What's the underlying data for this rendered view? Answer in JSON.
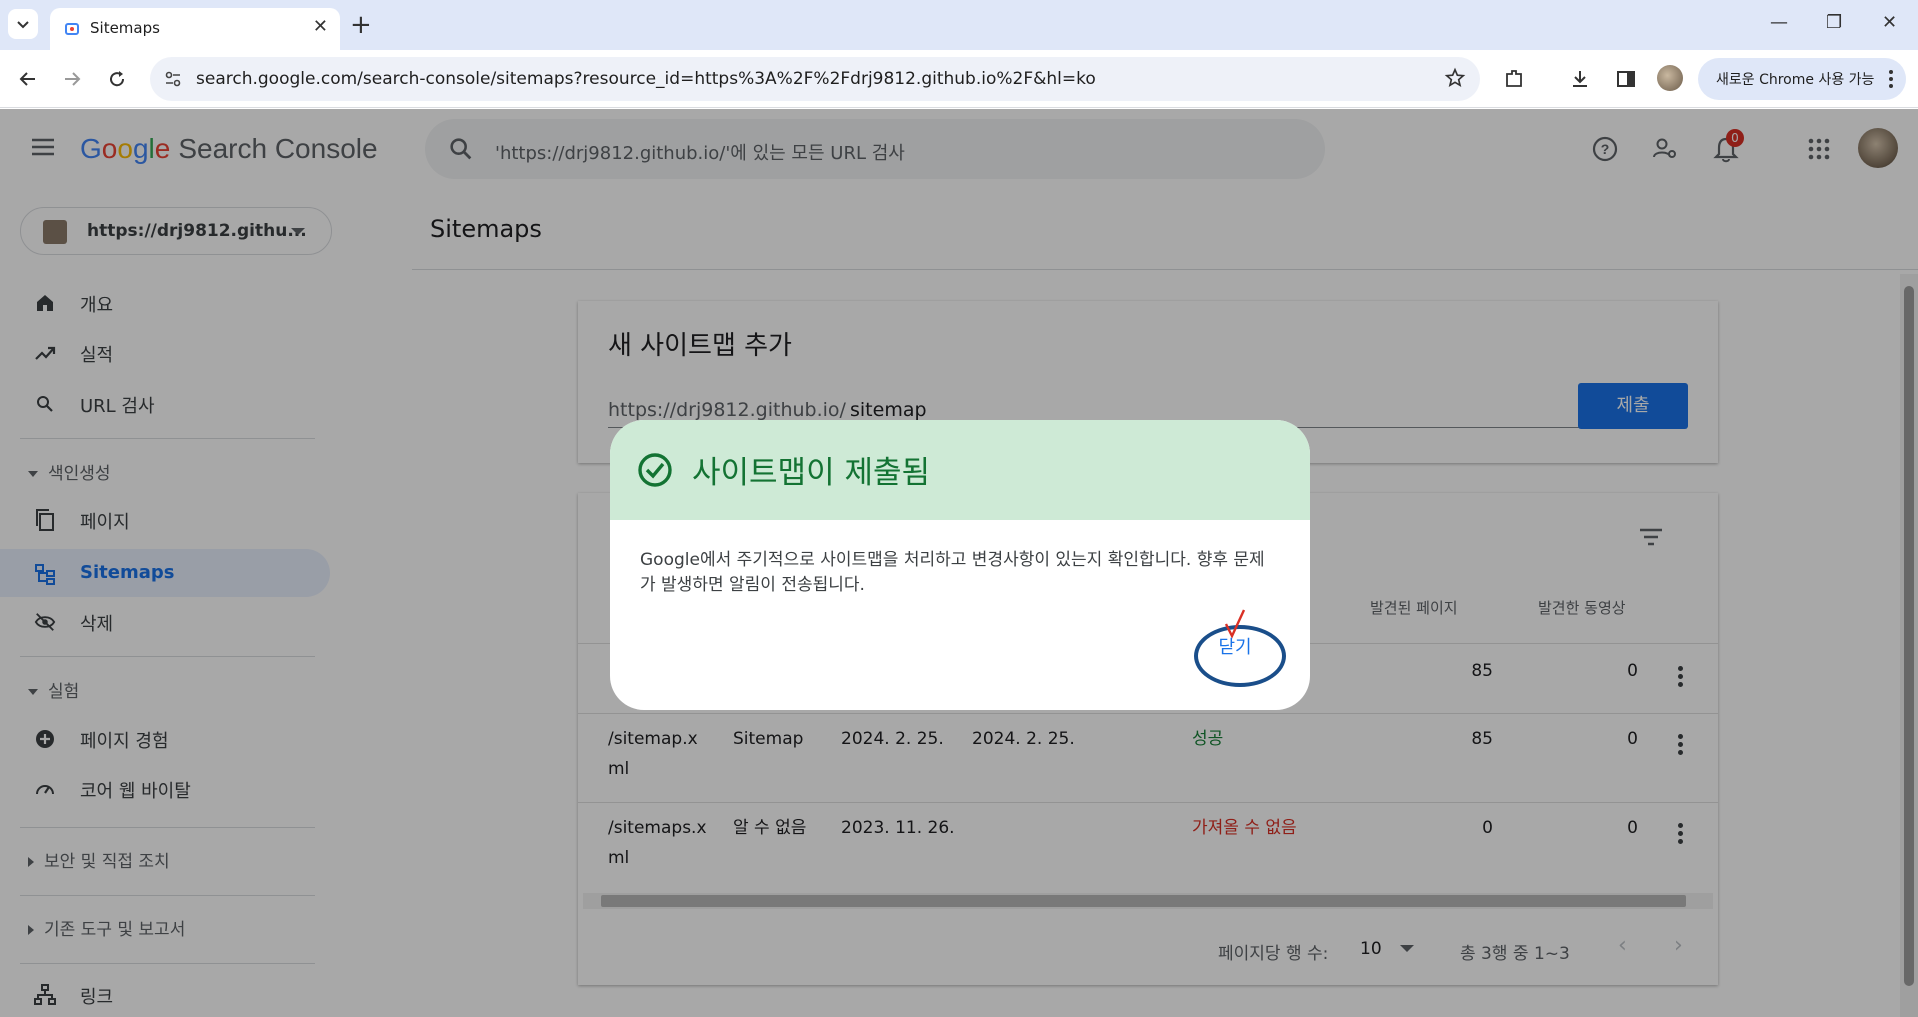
{
  "browser": {
    "tab_title": "Sitemaps",
    "url": "search.google.com/search-console/sitemaps?resource_id=https%3A%2F%2Fdrj9812.github.io%2F&hl=ko",
    "chrome_update": "새로운 Chrome 사용 가능"
  },
  "header": {
    "logo_letters": [
      "G",
      "o",
      "o",
      "g",
      "l",
      "e"
    ],
    "product": "Search Console",
    "search_placeholder": "'https://drj9812.github.io/'에 있는 모든 URL 검사",
    "notification_count": "0"
  },
  "sidebar": {
    "property": "https://drj9812.githu...",
    "items": [
      {
        "label": "개요",
        "icon": "home-icon"
      },
      {
        "label": "실적",
        "icon": "trending-up-icon"
      },
      {
        "label": "URL 검사",
        "icon": "search-icon"
      },
      {
        "label": "페이지",
        "icon": "pages-icon"
      },
      {
        "label": "Sitemaps",
        "icon": "sitemap-icon"
      },
      {
        "label": "삭제",
        "icon": "visibility-off-icon"
      },
      {
        "label": "페이지 경험",
        "icon": "add-circle-icon"
      },
      {
        "label": "코어 웹 바이탈",
        "icon": "speed-icon"
      },
      {
        "label": "링크",
        "icon": "links-icon"
      }
    ],
    "sections": [
      "색인생성",
      "실험",
      "보안 및 직접 조치",
      "기존 도구 및 보고서"
    ]
  },
  "main": {
    "title": "Sitemaps",
    "add_card": {
      "title": "새 사이트맵 추가",
      "prefix": "https://drj9812.github.io/",
      "value": "sitemap",
      "submit": "제출"
    },
    "table": {
      "headers": [
        "발견된 페이지",
        "발견한 동영상"
      ],
      "rows": [
        {
          "sitemap": "",
          "type": "",
          "submitted": "",
          "last_read": "",
          "status": "",
          "pages": "85",
          "videos": "0"
        },
        {
          "sitemap": "/sitemap.x",
          "sitemap2": "ml",
          "type": "Sitemap",
          "submitted": "2024. 2. 25.",
          "last_read": "2024. 2. 25.",
          "status": "성공",
          "pages": "85",
          "videos": "0"
        },
        {
          "sitemap": "/sitemaps.x",
          "sitemap2": "ml",
          "type": "알 수 없음",
          "submitted": "2023. 11. 26.",
          "last_read": "",
          "status": "가져올 수 없음",
          "pages": "0",
          "videos": "0"
        }
      ],
      "rows_per_page_label": "페이지당 행 수:",
      "rows_per_page": "10",
      "range": "총 3행 중 1~3"
    }
  },
  "dialog": {
    "title": "사이트맵이 제출됨",
    "body": "Google에서 주기적으로 사이트맵을 처리하고 변경사항이 있는지 확인합니다. 향후 문제가 발생하면 알림이 전송됩니다.",
    "close": "닫기"
  },
  "colors": {
    "accent": "#1a73e8",
    "success": "#188038",
    "error": "#d93025",
    "dialog_header": "#ceead6"
  }
}
